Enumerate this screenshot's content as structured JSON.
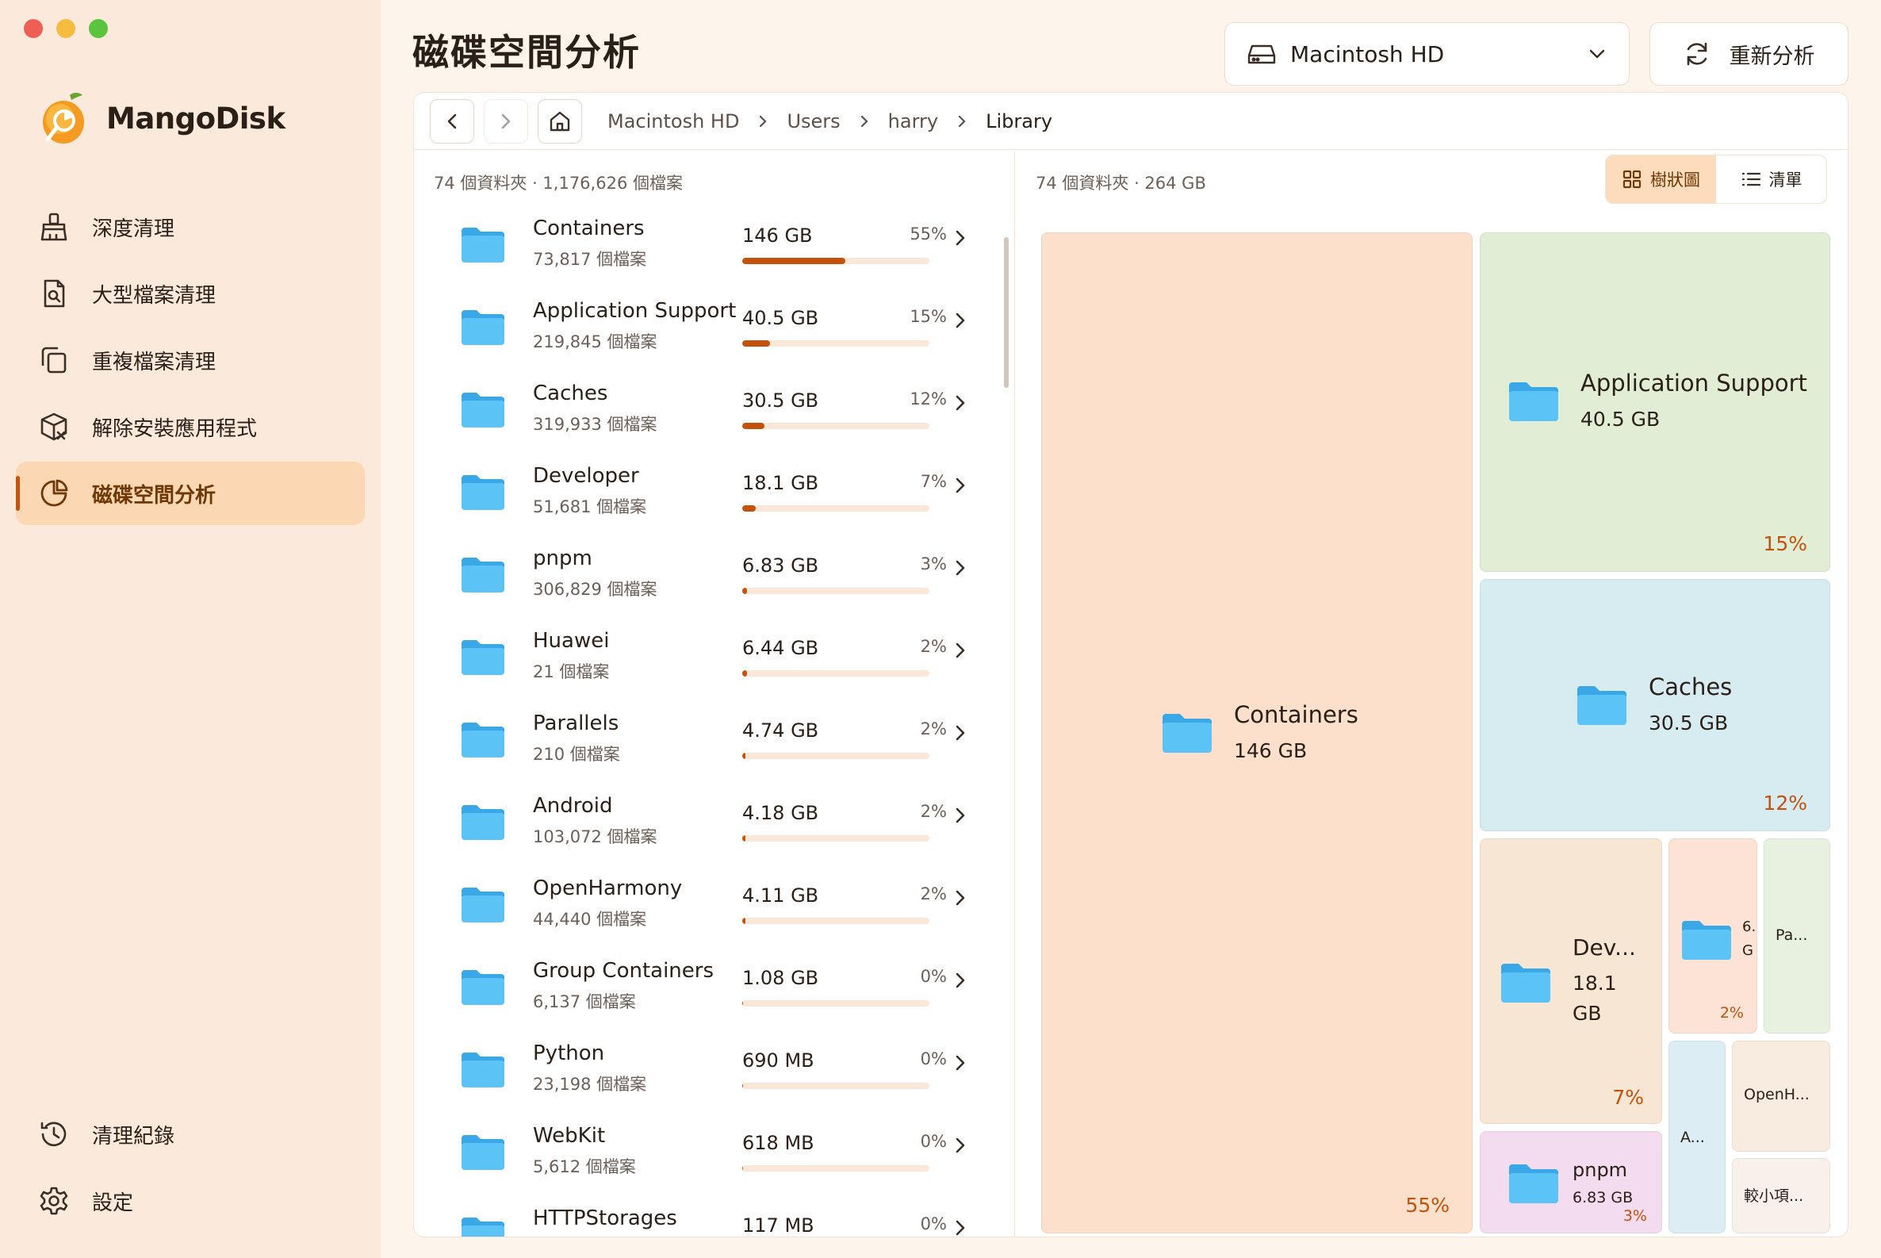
{
  "app": {
    "name": "MangoDisk"
  },
  "sidebar": {
    "items": [
      {
        "label": "深度清理",
        "icon": "broom-icon"
      },
      {
        "label": "大型檔案清理",
        "icon": "large-file-icon"
      },
      {
        "label": "重複檔案清理",
        "icon": "duplicate-icon"
      },
      {
        "label": "解除安裝應用程式",
        "icon": "uninstall-box-icon"
      },
      {
        "label": "磁碟空間分析",
        "icon": "pie-chart-icon",
        "active": true
      }
    ],
    "bottom_items": [
      {
        "label": "清理紀錄",
        "icon": "history-icon"
      },
      {
        "label": "設定",
        "icon": "gear-icon"
      }
    ]
  },
  "header": {
    "title": "磁碟空間分析",
    "disk_select": {
      "value": "Macintosh HD"
    },
    "rescan_label": "重新分析"
  },
  "breadcrumb": [
    "Macintosh HD",
    "Users",
    "harry",
    "Library"
  ],
  "list": {
    "summary": "74 個資料夾 · 1,176,626 個檔案",
    "rows": [
      {
        "name": "Containers",
        "count": "73,817 個檔案",
        "size": "146 GB",
        "pct": "55%",
        "fill": 55
      },
      {
        "name": "Application Support",
        "count": "219,845 個檔案",
        "size": "40.5 GB",
        "pct": "15%",
        "fill": 15
      },
      {
        "name": "Caches",
        "count": "319,933 個檔案",
        "size": "30.5 GB",
        "pct": "12%",
        "fill": 12
      },
      {
        "name": "Developer",
        "count": "51,681 個檔案",
        "size": "18.1 GB",
        "pct": "7%",
        "fill": 7
      },
      {
        "name": "pnpm",
        "count": "306,829 個檔案",
        "size": "6.83 GB",
        "pct": "3%",
        "fill": 2.6
      },
      {
        "name": "Huawei",
        "count": "21 個檔案",
        "size": "6.44 GB",
        "pct": "2%",
        "fill": 2.4
      },
      {
        "name": "Parallels",
        "count": "210 個檔案",
        "size": "4.74 GB",
        "pct": "2%",
        "fill": 1.8
      },
      {
        "name": "Android",
        "count": "103,072 個檔案",
        "size": "4.18 GB",
        "pct": "2%",
        "fill": 1.6
      },
      {
        "name": "OpenHarmony",
        "count": "44,440 個檔案",
        "size": "4.11 GB",
        "pct": "2%",
        "fill": 1.5
      },
      {
        "name": "Group Containers",
        "count": "6,137 個檔案",
        "size": "1.08 GB",
        "pct": "0%",
        "fill": 0.4
      },
      {
        "name": "Python",
        "count": "23,198 個檔案",
        "size": "690 MB",
        "pct": "0%",
        "fill": 0.3
      },
      {
        "name": "WebKit",
        "count": "5,612 個檔案",
        "size": "618 MB",
        "pct": "0%",
        "fill": 0.2
      },
      {
        "name": "HTTPStorages",
        "count": "",
        "size": "117 MB",
        "pct": "0%",
        "fill": 0.05
      }
    ]
  },
  "treemap": {
    "summary": "74 個資料夾 · 264 GB",
    "view_tree_label": "樹狀圖",
    "view_list_label": "清單",
    "tiles": [
      {
        "name": "Containers",
        "size": "146 GB",
        "pct": "55%"
      },
      {
        "name": "Application Support",
        "size": "40.5 GB",
        "pct": "15%"
      },
      {
        "name": "Caches",
        "size": "30.5 GB",
        "pct": "12%"
      },
      {
        "name": "Dev...",
        "size_l1": "18.1",
        "size_l2": "GB",
        "pct": "7%"
      },
      {
        "name_l1": "6.",
        "name_l2": "G",
        "pct": "2%"
      },
      {
        "name": "Pa..."
      },
      {
        "name": "A..."
      },
      {
        "name": "OpenH..."
      },
      {
        "name": "pnpm",
        "size": "6.83 GB",
        "pct": "3%"
      },
      {
        "name": "較小項..."
      }
    ],
    "colors": {
      "containers": "#fde0cc",
      "app_support": "#e2edd6",
      "caches": "#d6ecf1",
      "developer": "#f7e6d4",
      "huawei": "#fde3d5",
      "parallels": "#e8f1e0",
      "android": "#dcedf4",
      "openharmony": "#f8ebe0",
      "pnpm": "#f3dcef",
      "smaller": "#f7f1ea"
    }
  }
}
